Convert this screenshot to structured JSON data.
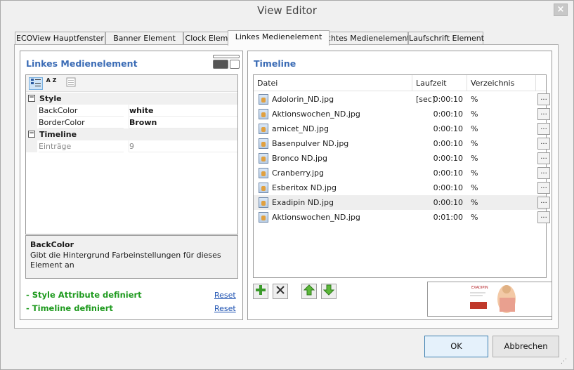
{
  "window": {
    "title": "View Editor",
    "close_label": "×"
  },
  "tabs": [
    {
      "label": "ECOView Hauptfenster"
    },
    {
      "label": "Banner Element"
    },
    {
      "label": "Clock Element"
    },
    {
      "label": "Linkes Medienelement"
    },
    {
      "label": "Rechtes Medienelement"
    },
    {
      "label": "Laufschrift Element"
    }
  ],
  "active_tab": "Linkes Medienelement",
  "left_panel": {
    "title": "Linkes Medienelement",
    "toolbar": {
      "categorized_icon": "categorized-icon",
      "alphabetical_label": "A Z",
      "property_pages_icon": "property-pages-icon"
    },
    "groups": [
      {
        "name": "Style",
        "toggle": "⊟",
        "properties": [
          {
            "name": "BackColor",
            "value": "white"
          },
          {
            "name": "BorderColor",
            "value": "Brown"
          }
        ]
      },
      {
        "name": "Timeline",
        "toggle": "⊟",
        "properties": [
          {
            "name": "Einträge",
            "value": "9"
          }
        ]
      }
    ],
    "help": {
      "title": "BackColor",
      "text": "Gibt die Hintergrund Farbeinstellungen für dieses Element an"
    },
    "status": [
      {
        "text": "- Style Attribute definiert",
        "link": "Reset"
      },
      {
        "text": "- Timeline definiert",
        "link": "Reset"
      }
    ]
  },
  "right_panel": {
    "title": "Timeline",
    "columns": [
      "Datei",
      "Laufzeit [sec]",
      "Verzeichnis"
    ],
    "rows": [
      {
        "file": "Adolorin_ND.jpg",
        "duration": "0:00:10",
        "dir": "%",
        "button": "..."
      },
      {
        "file": "Aktionswochen_ND.jpg",
        "duration": "0:00:10",
        "dir": "%",
        "button": "..."
      },
      {
        "file": "arnicet_ND.jpg",
        "duration": "0:00:10",
        "dir": "%",
        "button": "..."
      },
      {
        "file": "Basenpulver ND.jpg",
        "duration": "0:00:10",
        "dir": "%",
        "button": "..."
      },
      {
        "file": "Bronco ND.jpg",
        "duration": "0:00:10",
        "dir": "%",
        "button": "..."
      },
      {
        "file": "Cranberry.jpg",
        "duration": "0:00:10",
        "dir": "%",
        "button": "..."
      },
      {
        "file": "Esberitox ND.jpg",
        "duration": "0:00:10",
        "dir": "%",
        "button": "..."
      },
      {
        "file": "Exadipin ND.jpg",
        "duration": "0:00:10",
        "dir": "%",
        "button": "..."
      },
      {
        "file": "Aktionswochen_ND.jpg",
        "duration": "0:01:00",
        "dir": "%",
        "button": "..."
      }
    ],
    "selected_row": "Exadipin ND.jpg",
    "actions": [
      {
        "name": "add-icon",
        "glyph": "+",
        "color": "#3a9a2a"
      },
      {
        "name": "delete-icon",
        "glyph": "✕",
        "color": "#333333"
      },
      {
        "name": "move-up-icon",
        "glyph": "⇧",
        "color": "#3a9a2a"
      },
      {
        "name": "move-down-icon",
        "glyph": "⇩",
        "color": "#3a9a2a"
      }
    ],
    "preview": {
      "brand": "EXADIPIN"
    }
  },
  "buttons": {
    "ok": "OK",
    "cancel": "Abbrechen"
  },
  "colors": {
    "title_blue": "#3a6bb5",
    "status_green": "#1e9a1e",
    "link_blue": "#1a4fb0"
  }
}
